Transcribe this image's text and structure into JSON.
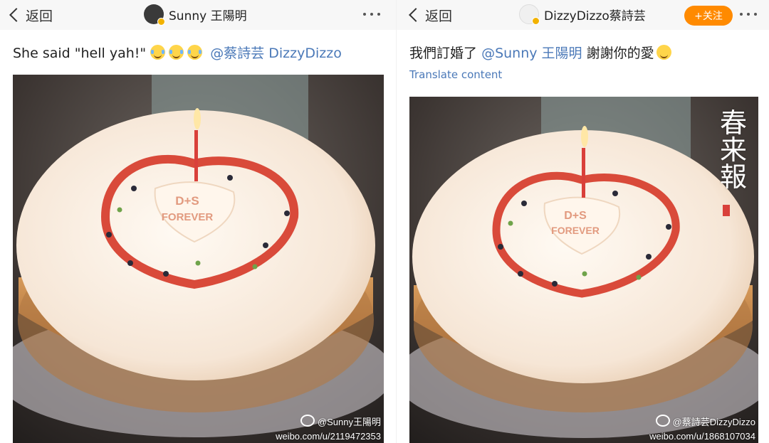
{
  "left": {
    "header": {
      "back_label": "返回",
      "profile_name": "Sunny 王陽明",
      "avatar_color": "#3a3a3a"
    },
    "post": {
      "text": "She said \"hell yah!\"",
      "emoji_icons": [
        "laughing-tears-emoji",
        "laughing-tears-emoji",
        "laughing-tears-emoji"
      ],
      "mention": "@蔡詩芸 DizzyDizzo"
    },
    "photo": {
      "cake_text_line1": "D+S",
      "cake_text_line2": "FOREVER",
      "watermark_handle": "@Sunny王陽明",
      "watermark_url": "weibo.com/u/2119472353"
    }
  },
  "right": {
    "header": {
      "back_label": "返回",
      "profile_name": "DizzyDizzo蔡詩芸",
      "follow_label": "+关注",
      "avatar_color": "#f0f0f0"
    },
    "post": {
      "text_before": "我們訂婚了",
      "mention": "@Sunny 王陽明",
      "text_after": "謝謝你的愛",
      "emoji_icon": "smile-emoji",
      "translate_label": "Translate content"
    },
    "photo": {
      "cake_text_line1": "D+S",
      "cake_text_line2": "FOREVER",
      "decor_text": "春来報",
      "watermark_handle": "@蔡詩芸DizzyDizzo",
      "watermark_url": "weibo.com/u/1868107034"
    }
  },
  "colors": {
    "accent_link": "#4b79b8",
    "follow_button": "#ff8a00",
    "header_bg": "#f7f7f7",
    "verified_badge": "#f2b200"
  }
}
